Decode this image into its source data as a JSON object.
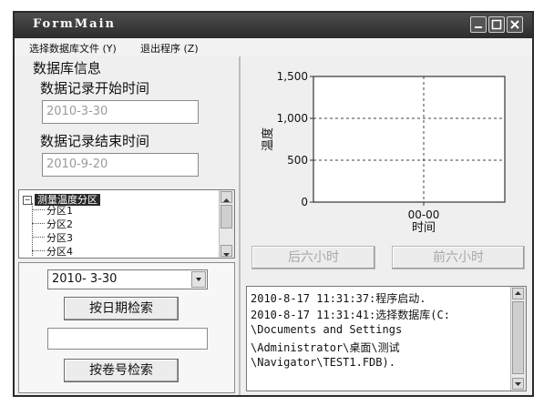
{
  "window": {
    "title": "FormMain"
  },
  "menu": [
    {
      "label": "选择数据库文件 (Y)"
    },
    {
      "label": "退出程序 (Z)"
    }
  ],
  "db_info": {
    "group_title": "数据库信息",
    "start_label": "数据记录开始时间",
    "start_value": "2010-3-30",
    "end_label": "数据记录结束时间",
    "end_value": "2010-9-20"
  },
  "tree": {
    "root": "测量温度分区",
    "items": [
      "分区1",
      "分区2",
      "分区3",
      "分区4"
    ]
  },
  "search": {
    "date_value": "2010- 3-30",
    "date_button": "按日期检索",
    "volume_value": "",
    "volume_button": "按卷号检索"
  },
  "chart_data": {
    "type": "line",
    "ylabel": "温度",
    "xlabel": "时间",
    "ylim": [
      0,
      1500
    ],
    "yticks": [
      "0",
      "500",
      "1,000",
      "1,500"
    ],
    "xticks": [
      "00-00"
    ],
    "grid": true,
    "series": []
  },
  "nav": {
    "prev_label": "后六小时",
    "next_label": "前六小时"
  },
  "log": {
    "lines": [
      "2010-8-17 11:31:37:程序启动.",
      "2010-8-17 11:31:41:选择数据库(C:",
      "\\Documents and Settings",
      "\\Administrator\\桌面\\测试",
      "\\Navigator\\TEST1.FDB)."
    ]
  }
}
